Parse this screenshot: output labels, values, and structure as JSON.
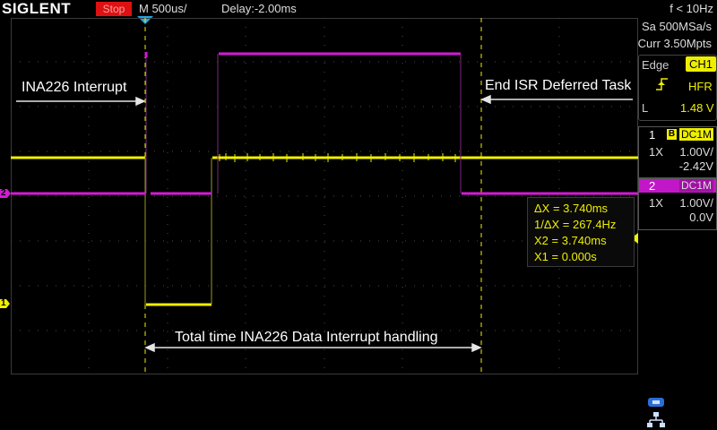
{
  "header": {
    "brand": "SIGLENT",
    "run_state": "Stop",
    "timebase": "M 500us/",
    "delay": "Delay:-2.00ms",
    "trigger_frequency": "f < 10Hz"
  },
  "acquisition": {
    "sample_rate": "Sa 500MSa/s",
    "memory_depth": "Curr 3.50Mpts"
  },
  "trigger": {
    "mode": "Edge",
    "source": "CH1",
    "coupling": "HFR",
    "level_label": "L",
    "level": "1.48 V",
    "slope_icon": "rising-edge-icon"
  },
  "channels": [
    {
      "number": "1",
      "bw_badge": "B",
      "coupling": "DC1M",
      "probe": "1X",
      "scale": "1.00V/",
      "offset": "-2.42V",
      "color": "#f0f000"
    },
    {
      "number": "2",
      "bw_badge": "",
      "coupling": "DC1M",
      "probe": "1X",
      "scale": "1.00V/",
      "offset": "0.0V",
      "color": "#d41ad6"
    }
  ],
  "cursors": {
    "delta_x": "ΔX = 3.740ms",
    "inv_delta_x": "1/ΔX = 267.4Hz",
    "x2": "X2 = 3.740ms",
    "x1": "X1 = 0.000s"
  },
  "annotations": {
    "left": "INA226 Interrupt",
    "right": "End ISR Deferred Task",
    "bottom": "Total time INA226 Data Interrupt handling"
  },
  "markers": {
    "ch1_ground": "1",
    "ch2_ground": "2"
  },
  "colors": {
    "ch1": "#f0f000",
    "ch2": "#d41ad6",
    "trigger_marker": "#27a6e6",
    "stop": "#dd1111"
  },
  "status_icons": [
    "usb-icon",
    "lan-icon"
  ]
}
